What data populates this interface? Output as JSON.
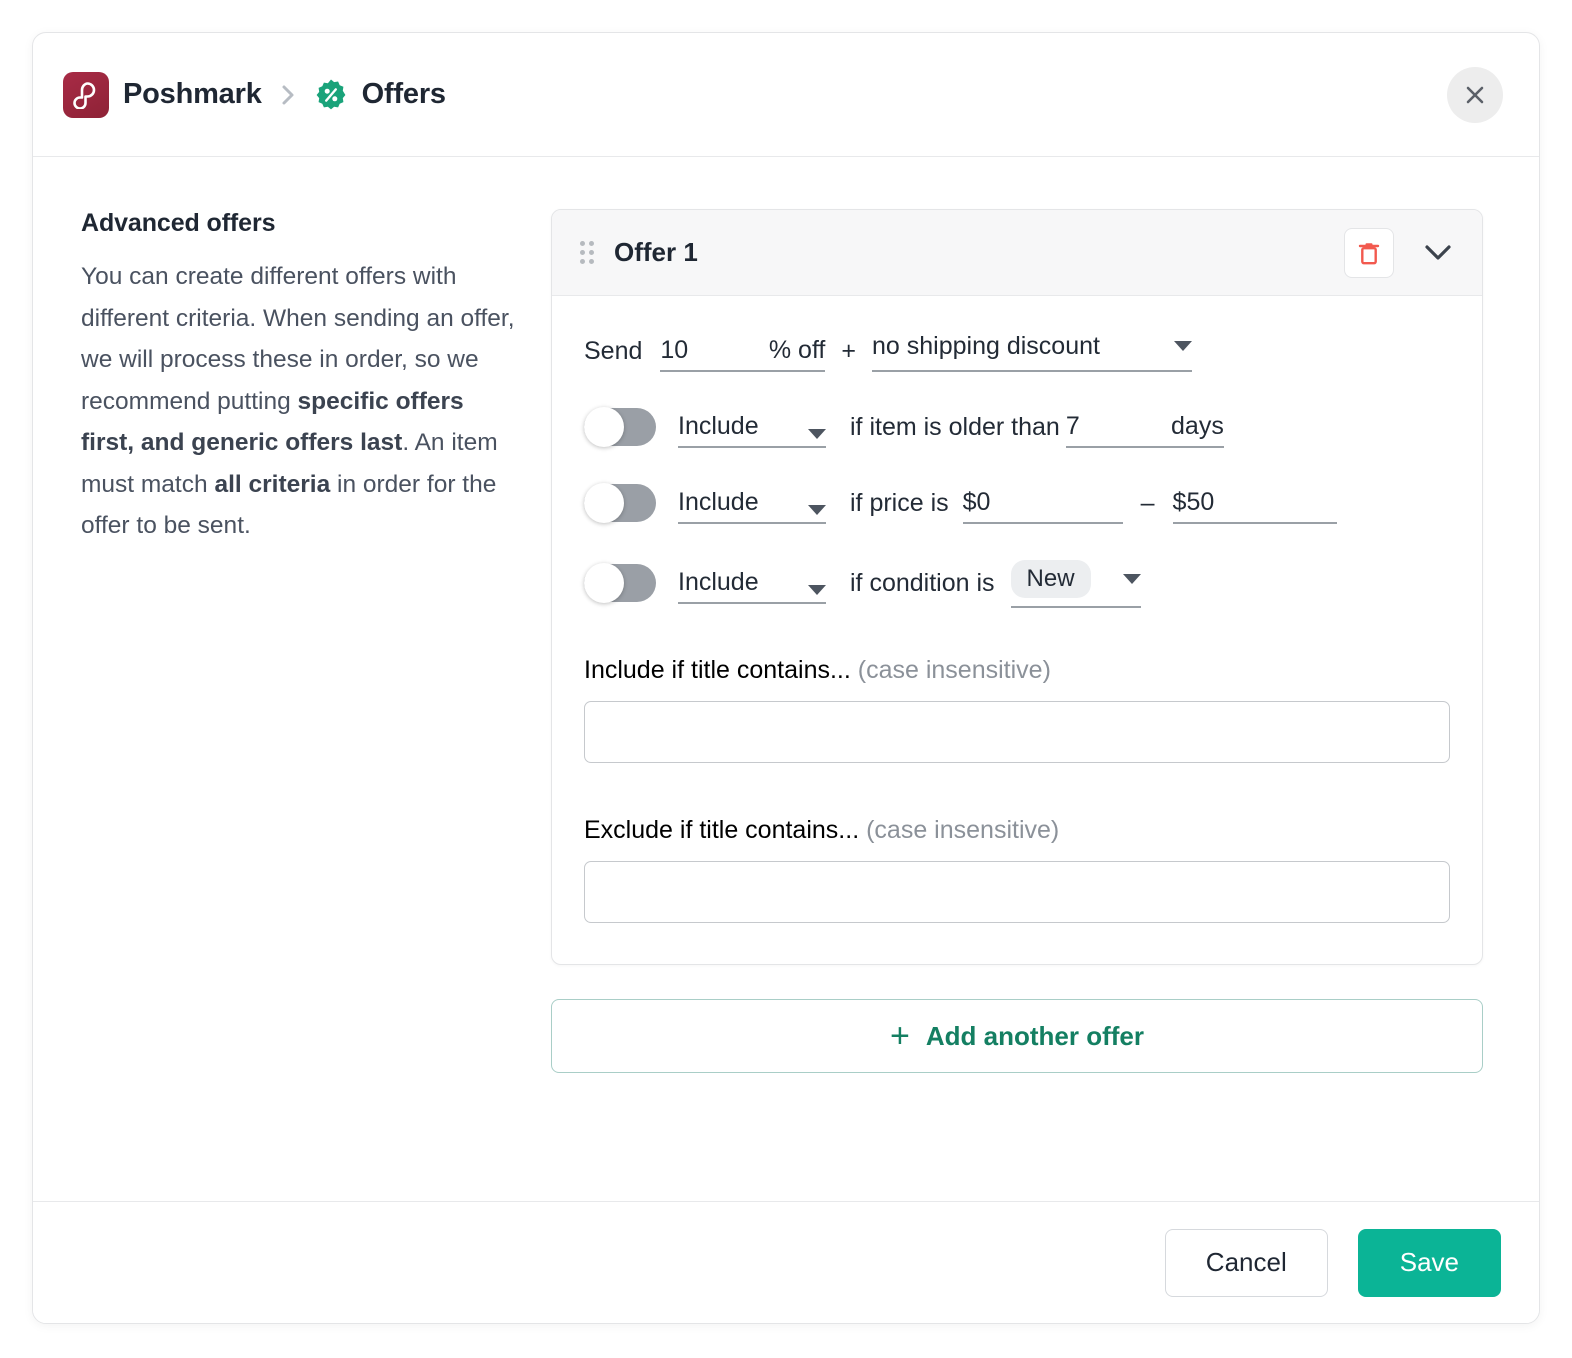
{
  "header": {
    "app_name": "Poshmark",
    "separator": "›",
    "section": "Offers",
    "logo_icon": "poshmark-logo",
    "section_icon": "discount-badge-icon",
    "close_icon": "close-icon",
    "brand_color": "#9b2743",
    "accent_color": "#1aa37a"
  },
  "left": {
    "title": "Advanced offers",
    "paragraph_parts": [
      {
        "text": "You can create different offers with different criteria. When sending an offer, we will process these in order, so we recommend putting ",
        "bold": false
      },
      {
        "text": "specific offers first, and generic offers last",
        "bold": true
      },
      {
        "text": ". An item must match ",
        "bold": false
      },
      {
        "text": "all criteria",
        "bold": true
      },
      {
        "text": " in order for the offer to be sent.",
        "bold": false
      }
    ]
  },
  "offer": {
    "title": "Offer 1",
    "drag_icon": "drag-handle-icon",
    "delete_icon": "trash-icon",
    "collapse_icon": "chevron-down-icon",
    "send": {
      "label": "Send",
      "discount_value": "10",
      "discount_unit": "% off",
      "plus": "+",
      "shipping_value": "no shipping discount"
    },
    "criteria": [
      {
        "toggle_on": false,
        "mode": "Include",
        "text": "if item is older than",
        "value": "7",
        "unit": "days"
      },
      {
        "toggle_on": false,
        "mode": "Include",
        "text": "if price is",
        "min": "$0",
        "dash": "–",
        "max": "$50"
      },
      {
        "toggle_on": false,
        "mode": "Include",
        "text": "if condition is",
        "condition": "New"
      }
    ],
    "include_title": {
      "label": "Include if title contains...",
      "hint": "(case insensitive)",
      "value": ""
    },
    "exclude_title": {
      "label": "Exclude if title contains...",
      "hint": "(case insensitive)",
      "value": ""
    }
  },
  "add_offer": {
    "plus": "+",
    "label": "Add another offer"
  },
  "footer": {
    "cancel_label": "Cancel",
    "save_label": "Save"
  }
}
